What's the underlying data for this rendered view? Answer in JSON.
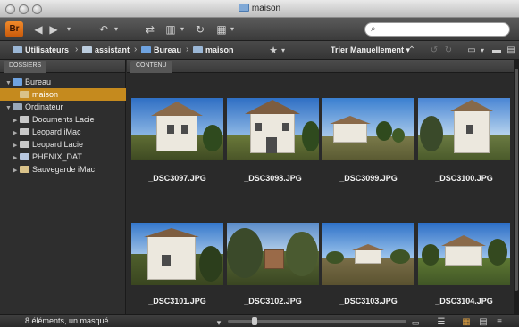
{
  "window": {
    "title": "maison"
  },
  "toolbar": {
    "app_logo": "Br",
    "search_placeholder": ""
  },
  "breadcrumb": [
    {
      "label": "Utilisateurs"
    },
    {
      "label": "assistant"
    },
    {
      "label": "Bureau"
    },
    {
      "label": "maison"
    }
  ],
  "sort": {
    "label": "Trier Manuellement"
  },
  "left_panel": {
    "tab": "DOSSIERS",
    "tree": [
      {
        "label": "Bureau",
        "level": 0,
        "expanded": true,
        "icon": "desktop-folder-icon"
      },
      {
        "label": "maison",
        "level": 1,
        "selected": true,
        "icon": "folder-icon"
      },
      {
        "label": "Ordinateur",
        "level": 0,
        "expanded": true,
        "icon": "computer-icon"
      },
      {
        "label": "Documents Lacie",
        "level": 1,
        "icon": "drive-icon"
      },
      {
        "label": "Leopard iMac",
        "level": 1,
        "icon": "drive-icon"
      },
      {
        "label": "Leopard Lacie",
        "level": 1,
        "icon": "drive-icon"
      },
      {
        "label": "PHENIX_DAT",
        "level": 1,
        "icon": "drive-icon"
      },
      {
        "label": "Sauvegarde iMac",
        "level": 1,
        "icon": "drive-icon"
      }
    ]
  },
  "content_panel": {
    "tab": "CONTENU",
    "items": [
      {
        "filename": "_DSC3097.JPG"
      },
      {
        "filename": "_DSC3098.JPG"
      },
      {
        "filename": "_DSC3099.JPG"
      },
      {
        "filename": "_DSC3100.JPG"
      },
      {
        "filename": "_DSC3101.JPG"
      },
      {
        "filename": "_DSC3102.JPG"
      },
      {
        "filename": "_DSC3103.JPG"
      },
      {
        "filename": "_DSC3104.JPG"
      }
    ]
  },
  "status": {
    "text": "8 éléments, un masqué"
  },
  "colors": {
    "selection": "#c58a1e",
    "bridge_orange": "#e07a1f",
    "panel_bg": "#2b2b2b"
  }
}
